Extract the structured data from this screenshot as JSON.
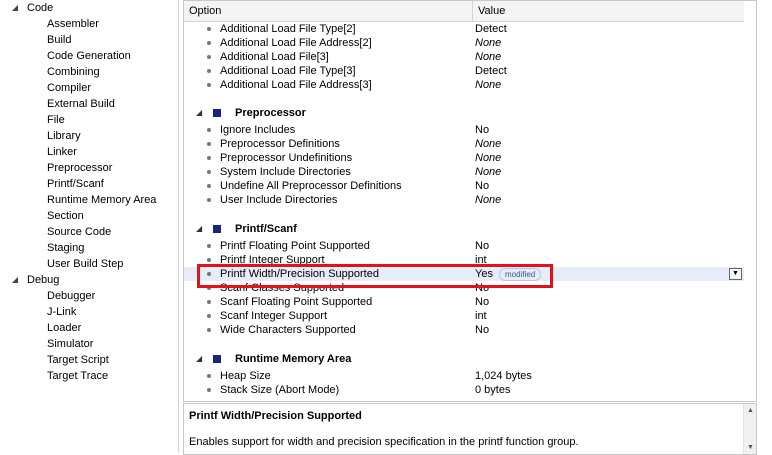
{
  "tree": {
    "categories": [
      {
        "label": "Code",
        "children": [
          "Assembler",
          "Build",
          "Code Generation",
          "Combining",
          "Compiler",
          "External Build",
          "File",
          "Library",
          "Linker",
          "Preprocessor",
          "Printf/Scanf",
          "Runtime Memory Area",
          "Section",
          "Source Code",
          "Staging",
          "User Build Step"
        ]
      },
      {
        "label": "Debug",
        "children": [
          "Debugger",
          "J-Link",
          "Loader",
          "Simulator",
          "Target Script",
          "Target Trace"
        ]
      }
    ]
  },
  "grid": {
    "header": {
      "option": "Option",
      "value": "Value"
    },
    "top_rows": [
      {
        "option": "Additional Load File Type[2]",
        "value": "Detect",
        "italic": false
      },
      {
        "option": "Additional Load File Address[2]",
        "value": "None",
        "italic": true
      },
      {
        "option": "Additional Load File[3]",
        "value": "None",
        "italic": true
      },
      {
        "option": "Additional Load File Type[3]",
        "value": "Detect",
        "italic": false
      },
      {
        "option": "Additional Load File Address[3]",
        "value": "None",
        "italic": true
      }
    ],
    "sections": [
      {
        "title": "Preprocessor",
        "rows": [
          {
            "option": "Ignore Includes",
            "value": "No",
            "italic": false
          },
          {
            "option": "Preprocessor Definitions",
            "value": "None",
            "italic": true
          },
          {
            "option": "Preprocessor Undefinitions",
            "value": "None",
            "italic": true
          },
          {
            "option": "System Include Directories",
            "value": "None",
            "italic": true
          },
          {
            "option": "Undefine All Preprocessor Definitions",
            "value": "No",
            "italic": false
          },
          {
            "option": "User Include Directories",
            "value": "None",
            "italic": true
          }
        ]
      },
      {
        "title": "Printf/Scanf",
        "rows": [
          {
            "option": "Printf Floating Point Supported",
            "value": "No",
            "italic": false
          },
          {
            "option": "Printf Integer Support",
            "value": "int",
            "italic": false
          },
          {
            "option": "Printf Width/Precision Supported",
            "value": "Yes",
            "italic": false,
            "badge": "modified",
            "selected": true
          },
          {
            "option": "Scanf Classes Supported",
            "value": "No",
            "italic": false
          },
          {
            "option": "Scanf Floating Point Supported",
            "value": "No",
            "italic": false
          },
          {
            "option": "Scanf Integer Support",
            "value": "int",
            "italic": false
          },
          {
            "option": "Wide Characters Supported",
            "value": "No",
            "italic": false
          }
        ]
      },
      {
        "title": "Runtime Memory Area",
        "rows": [
          {
            "option": "Heap Size",
            "value": "1,024 bytes",
            "italic": false
          },
          {
            "option": "Stack Size (Abort Mode)",
            "value": "0 bytes",
            "italic": false
          }
        ]
      }
    ]
  },
  "description": {
    "title": "Printf Width/Precision Supported",
    "text": "Enables support for width and precision specification in the printf function group."
  },
  "colors": {
    "highlight": "#e0121c",
    "section_square": "#1a237e",
    "selected_row": "#e6ecf8"
  },
  "icons": {
    "expand": "triangle-down-icon",
    "bullet": "bullet-icon",
    "dropdown": "dropdown-arrow-icon"
  }
}
